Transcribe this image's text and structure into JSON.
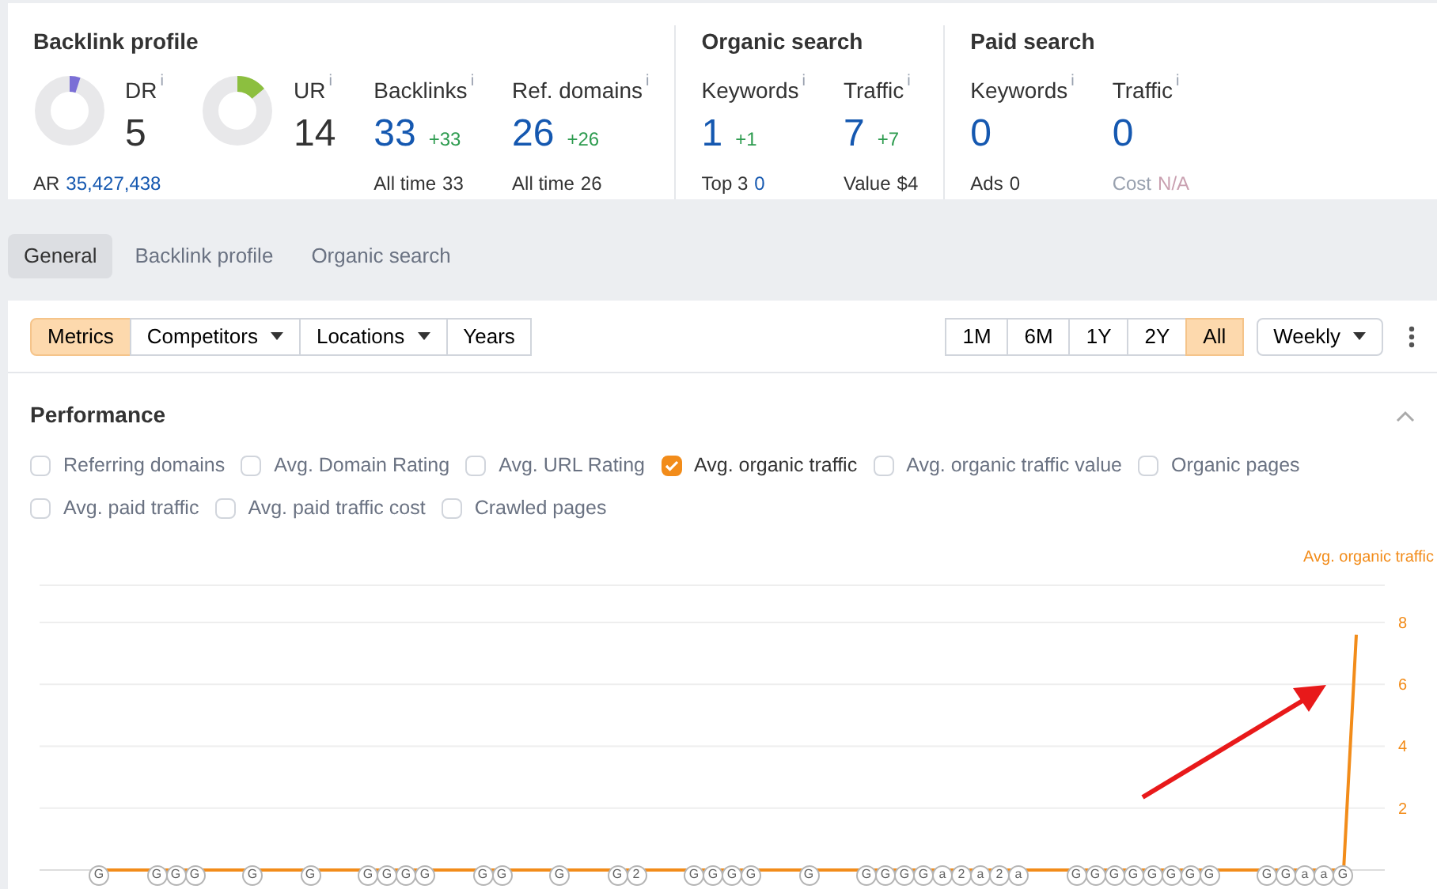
{
  "overview": {
    "sections": [
      {
        "title": "Backlink profile",
        "metrics": [
          {
            "kind": "ring",
            "label": "DR",
            "info": "i",
            "value": "5",
            "level": 0.05,
            "color": "#7b6fd6",
            "foot_label": "AR",
            "foot_value": "35,427,438",
            "foot_link": true
          },
          {
            "kind": "ring",
            "label": "UR",
            "info": "i",
            "value": "14",
            "level": 0.14,
            "color": "#8cbf3f"
          },
          {
            "kind": "number",
            "label": "Backlinks",
            "info": "i",
            "value": "33",
            "delta": "+33",
            "foot_label": "All time",
            "foot_value": "33",
            "foot_link": false
          },
          {
            "kind": "number",
            "label": "Ref. domains",
            "info": "i",
            "value": "26",
            "delta": "+26",
            "foot_label": "All time",
            "foot_value": "26",
            "foot_link": false
          }
        ]
      },
      {
        "title": "Organic search",
        "metrics": [
          {
            "kind": "number",
            "label": "Keywords",
            "info": "i",
            "value": "1",
            "delta": "+1",
            "foot_label": "Top 3",
            "foot_value": "0",
            "foot_link": true
          },
          {
            "kind": "number",
            "label": "Traffic",
            "info": "i",
            "value": "7",
            "delta": "+7",
            "foot_label": "Value",
            "foot_value": "$4",
            "foot_link": false
          }
        ]
      },
      {
        "title": "Paid search",
        "metrics": [
          {
            "kind": "number",
            "label": "Keywords",
            "info": "i",
            "value": "0",
            "foot_label": "Ads",
            "foot_value": "0",
            "foot_link": false,
            "foot_disabled": false
          },
          {
            "kind": "number",
            "label": "Traffic",
            "info": "i",
            "value": "0",
            "foot_label": "Cost",
            "foot_value": "N/A",
            "foot_link": false,
            "foot_disabled": true
          }
        ]
      }
    ]
  },
  "tabs": [
    {
      "label": "General",
      "selected": true
    },
    {
      "label": "Backlink profile",
      "selected": false
    },
    {
      "label": "Organic search",
      "selected": false
    }
  ],
  "toolbar": {
    "left": [
      {
        "label": "Metrics",
        "selected": true,
        "dropdown": false
      },
      {
        "label": "Competitors",
        "selected": false,
        "dropdown": true
      },
      {
        "label": "Locations",
        "selected": false,
        "dropdown": true
      },
      {
        "label": "Years",
        "selected": false,
        "dropdown": false
      }
    ],
    "ranges": [
      {
        "label": "1M",
        "selected": false
      },
      {
        "label": "6M",
        "selected": false
      },
      {
        "label": "1Y",
        "selected": false
      },
      {
        "label": "2Y",
        "selected": false
      },
      {
        "label": "All",
        "selected": true
      }
    ],
    "interval": "Weekly"
  },
  "performance": {
    "title": "Performance",
    "expanded": true,
    "options": [
      {
        "label": "Referring domains",
        "checked": false
      },
      {
        "label": "Avg. Domain Rating",
        "checked": false
      },
      {
        "label": "Avg. URL Rating",
        "checked": false
      },
      {
        "label": "Avg. organic traffic",
        "checked": true
      },
      {
        "label": "Avg. organic traffic value",
        "checked": false
      },
      {
        "label": "Organic pages",
        "checked": false
      },
      {
        "label": "Avg. paid traffic",
        "checked": false
      },
      {
        "label": "Avg. paid traffic cost",
        "checked": false
      },
      {
        "label": "Crawled pages",
        "checked": false
      }
    ],
    "chart_data": {
      "type": "line",
      "categories": [
        null,
        null,
        null,
        null,
        null,
        null,
        null,
        null,
        null,
        null,
        null,
        null,
        null,
        null,
        null,
        null,
        null,
        null,
        null,
        null,
        null,
        null,
        null,
        null,
        null,
        null,
        null,
        null,
        null,
        null,
        null,
        null,
        null,
        null,
        null,
        null,
        null,
        null,
        null,
        null,
        null,
        null,
        null,
        null,
        null,
        null,
        null,
        null,
        null,
        null,
        null,
        null,
        null,
        null,
        null,
        null,
        null,
        null,
        null,
        null,
        null,
        null,
        null,
        null,
        null,
        null,
        null,
        null,
        null,
        null,
        null,
        null,
        null,
        null,
        null,
        null,
        null,
        null,
        null,
        null,
        null,
        null,
        null,
        null,
        null,
        null,
        null,
        null,
        null,
        null,
        null,
        null,
        null,
        null,
        null,
        null,
        null,
        null,
        null,
        null
      ],
      "ylim": [
        0,
        9.2
      ],
      "yticks": [
        2,
        4,
        6,
        8
      ],
      "grid": true,
      "series": [
        {
          "name": "Avg. organic traffic",
          "color": "#f28c1a",
          "values": [
            0,
            0,
            0,
            0,
            0,
            0,
            0,
            0,
            0,
            0,
            0,
            0,
            0,
            0,
            0,
            0,
            0,
            0,
            0,
            0,
            0,
            0,
            0,
            0,
            0,
            0,
            0,
            0,
            0,
            0,
            0,
            0,
            0,
            0,
            0,
            0,
            0,
            0,
            0,
            0,
            0,
            0,
            0,
            0,
            0,
            0,
            0,
            0,
            0,
            0,
            0,
            0,
            0,
            0,
            0,
            0,
            0,
            0,
            0,
            0,
            0,
            0,
            0,
            0,
            0,
            0,
            0,
            0,
            0,
            0,
            0,
            0,
            0,
            0,
            0,
            0,
            0,
            0,
            0,
            0,
            0,
            0,
            0,
            0,
            0,
            0,
            0,
            0,
            0,
            0,
            0,
            0,
            0,
            0,
            0,
            0,
            0,
            0,
            0,
            7.6
          ]
        }
      ]
    },
    "event_markers": [
      {
        "labels": [
          "G"
        ]
      },
      {
        "labels": [
          "G",
          "G",
          "G"
        ]
      },
      {
        "labels": [
          "G"
        ]
      },
      {
        "labels": [
          "G"
        ]
      },
      {
        "labels": [
          "G",
          "G",
          "G",
          "G"
        ]
      },
      {
        "labels": [
          "G",
          "G"
        ]
      },
      {
        "labels": [
          "G"
        ]
      },
      {
        "labels": [
          "G",
          "2"
        ]
      },
      {
        "labels": [
          "G",
          "G",
          "G",
          "G"
        ]
      },
      {
        "labels": [
          "G"
        ]
      },
      {
        "labels": [
          "G",
          "G",
          "G",
          "G",
          "a",
          "2",
          "a",
          "2",
          "a"
        ]
      },
      {
        "labels": [
          "G",
          "G",
          "G",
          "G",
          "G",
          "G",
          "G",
          "G"
        ]
      },
      {
        "labels": [
          "G",
          "G",
          "a",
          "a",
          "G"
        ]
      }
    ]
  }
}
